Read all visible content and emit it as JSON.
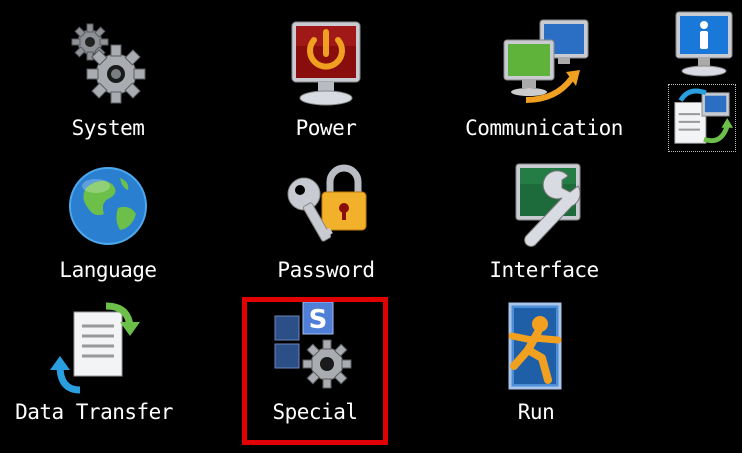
{
  "menu": {
    "items": [
      {
        "id": "system",
        "label": "System",
        "icon": "gear-icon"
      },
      {
        "id": "power",
        "label": "Power",
        "icon": "power-icon"
      },
      {
        "id": "communication",
        "label": "Communication",
        "icon": "network-icon"
      },
      {
        "id": "language",
        "label": "Language",
        "icon": "globe-icon"
      },
      {
        "id": "password",
        "label": "Password",
        "icon": "padlock-key-icon"
      },
      {
        "id": "interface",
        "label": "Interface",
        "icon": "wrench-icon"
      },
      {
        "id": "data_transfer",
        "label": "Data Transfer",
        "icon": "document-transfer-icon"
      },
      {
        "id": "special",
        "label": "Special",
        "icon": "special-gear-icon"
      },
      {
        "id": "run",
        "label": "Run",
        "icon": "running-man-icon"
      }
    ]
  },
  "side": {
    "info_icon": "info-icon",
    "remote_icon": "remote-document-icon"
  },
  "selected_item": "special",
  "colors": {
    "background": "#000000",
    "label_text": "#ffffff",
    "highlight": "#e00000"
  }
}
